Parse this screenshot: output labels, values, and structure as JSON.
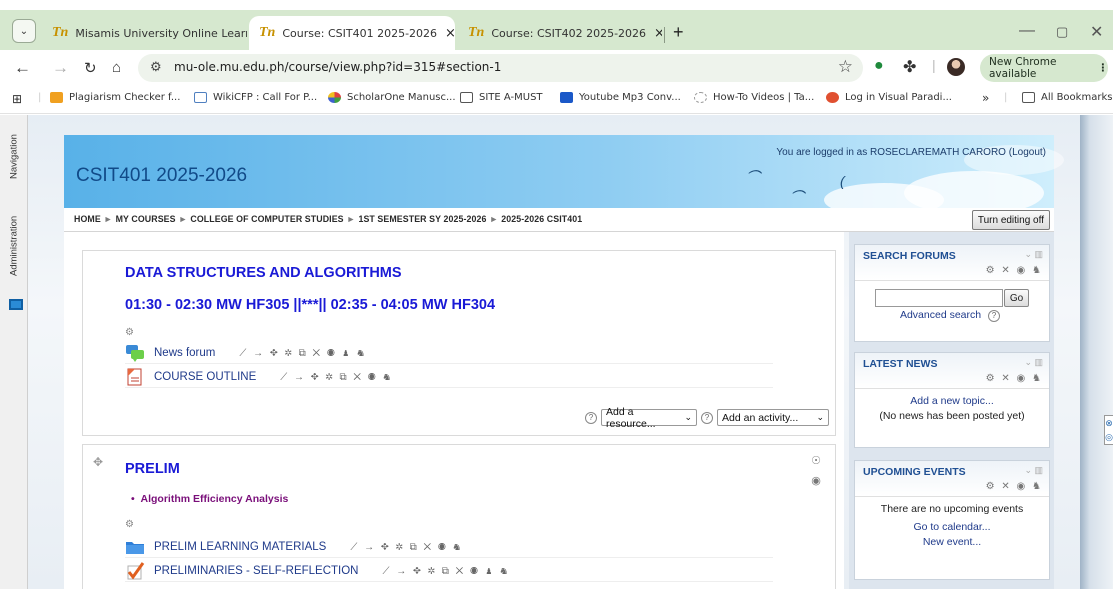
{
  "browser": {
    "tabs": [
      {
        "title": "Misamis University Online Learn",
        "active": false
      },
      {
        "title": "Course: CSIT401 2025-2026",
        "active": true
      },
      {
        "title": "Course: CSIT402 2025-2026",
        "active": false
      }
    ],
    "tab_favicon": "Tn",
    "tab_close": "×",
    "new_tab": "+",
    "url": "mu-ole.mu.edu.ph/course/view.php?id=315#section-1",
    "new_chrome": "New Chrome available",
    "bookmarks": [
      "Plagiarism Checker f...",
      "WikiCFP : Call For P...",
      "ScholarOne Manusc...",
      "SITE A-MUST",
      "Youtube Mp3 Conv...",
      "How-To Videos | Ta...",
      "Log in Visual Paradi..."
    ],
    "bookmarks_overflow": "»",
    "all_bookmarks": "All Bookmarks"
  },
  "dock": {
    "navigation": "Navigation",
    "administration": "Administration"
  },
  "header": {
    "site_title": "CSIT401 2025-2026",
    "login_prefix": "You are logged in as ROSECLAREMATH CARORO",
    "logout": "(Logout)"
  },
  "breadcrumb": {
    "items": [
      "HOME",
      "MY COURSES",
      "COLLEGE OF COMPUTER STUDIES",
      "1ST SEMESTER SY 2025-2026",
      "2025-2026 CSIT401"
    ],
    "separator": "►"
  },
  "editing_button": "Turn editing off",
  "section0": {
    "title": "DATA STRUCTURES AND ALGORITHMS",
    "schedule": "01:30 - 02:30 MW HF305 ||***|| 02:35 - 04:05 MW HF304",
    "activities": [
      {
        "name": "News forum",
        "tools": "⟋ → ✥ ✲ ⧉ ✕ ◉ ♟ ♞"
      },
      {
        "name": "COURSE OUTLINE",
        "tools": "⟋ → ✥ ✲ ⧉ ✕ ◉ ♞"
      }
    ],
    "add_resource": "Add a resource...",
    "add_activity": "Add an activity..."
  },
  "section1": {
    "title": "PRELIM",
    "topic": "Algorithm Efficiency Analysis",
    "activities": [
      {
        "name": "PRELIM LEARNING MATERIALS",
        "tools": "⟋ → ✥ ✲ ⧉ ✕ ◉ ♞"
      },
      {
        "name": "PRELIMINARIES - SELF-REFLECTION",
        "tools": "⟋ → ✥ ✲ ⧉ ✕ ◉ ♟ ♞"
      }
    ]
  },
  "blocks": {
    "search_forums": {
      "title": "SEARCH FORUMS",
      "go": "Go",
      "advanced": "Advanced search"
    },
    "latest_news": {
      "title": "LATEST NEWS",
      "add_topic": "Add a new topic...",
      "no_news": "(No news has been posted yet)"
    },
    "upcoming_events": {
      "title": "UPCOMING EVENTS",
      "none": "There are no upcoming events",
      "calendar": "Go to calendar...",
      "new_event": "New event..."
    },
    "tools_3": "⚙ ✕ ◉ ♞",
    "tools_2": "⚙ ✕ ◉ ♞"
  }
}
